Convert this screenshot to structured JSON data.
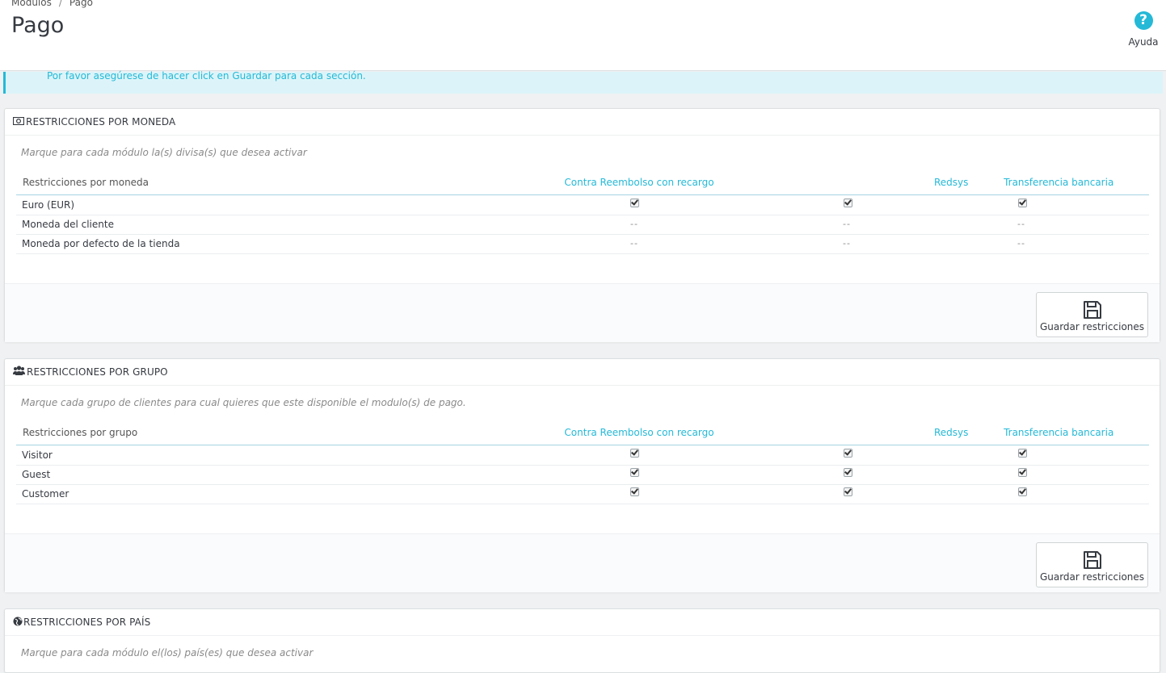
{
  "breadcrumb": {
    "parent": "Modulos",
    "separator": "/",
    "current": "Pago"
  },
  "page_title": "Pago",
  "help": {
    "label": "Ayuda",
    "icon": "question-circle-icon"
  },
  "alert": {
    "text": "Por favor asegúrese de hacer click en Guardar para cada sección."
  },
  "modules": [
    "Contra Reembolso con recargo",
    "Redsys",
    "Transferencia bancaria"
  ],
  "currency_panel": {
    "title": "RESTRICCIONES POR MONEDA",
    "icon": "money-icon",
    "hint": "Marque para cada módulo la(s) divisa(s) que desea activar",
    "first_column": "Restricciones por moneda",
    "rows": [
      {
        "label": "Euro (EUR)",
        "cells": [
          "check",
          "check",
          "check"
        ]
      },
      {
        "label": "Moneda del cliente",
        "cells": [
          "--",
          "--",
          "--"
        ]
      },
      {
        "label": "Moneda por defecto de la tienda",
        "cells": [
          "--",
          "--",
          "--"
        ]
      }
    ],
    "save_label": "Guardar restricciones"
  },
  "group_panel": {
    "title": "RESTRICCIONES POR GRUPO",
    "icon": "group-icon",
    "hint": "Marque cada grupo de clientes para cual quieres que este disponible el modulo(s) de pago.",
    "first_column": "Restricciones por grupo",
    "rows": [
      {
        "label": "Visitor",
        "cells": [
          "check",
          "check",
          "check"
        ]
      },
      {
        "label": "Guest",
        "cells": [
          "check",
          "check",
          "check"
        ]
      },
      {
        "label": "Customer",
        "cells": [
          "check",
          "check",
          "check"
        ]
      }
    ],
    "save_label": "Guardar restricciones"
  },
  "country_panel": {
    "title": "RESTRICCIONES POR PAÍS",
    "icon": "globe-icon",
    "hint": "Marque para cada módulo el(los) país(es) que desea activar"
  },
  "colors": {
    "accent": "#25b9d7",
    "alert_bg": "#dcf4f9",
    "page_bg": "#eff1f2"
  }
}
